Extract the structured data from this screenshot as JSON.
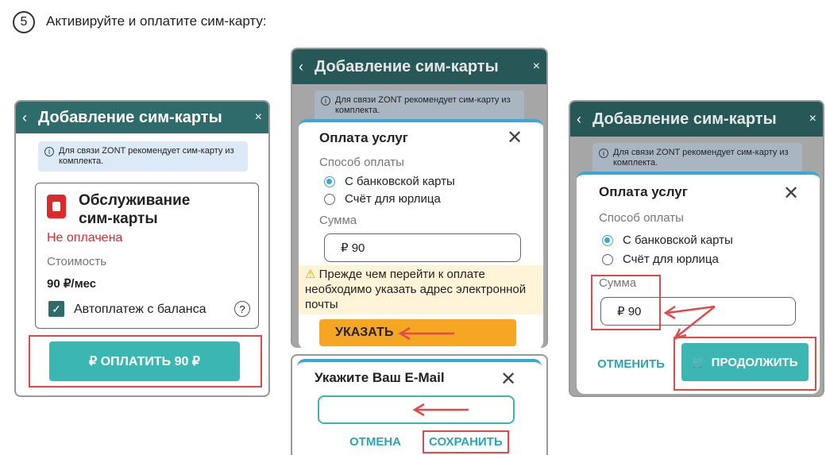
{
  "step": {
    "number": "5",
    "title": "Активируйте и оплатите сим-карту:"
  },
  "screen1": {
    "back": "‹",
    "title": "Добавление сим-карты",
    "close": "×",
    "info": "Для связи ZONT рекомендует сим-карту из комплекта.",
    "card_title": "Обслуживание сим-карты",
    "status": "Не оплачена",
    "cost_label": "Стоимость",
    "cost_value": "90 ₽/мес",
    "autopay_label": "Автоплатеж с баланса",
    "help": "?",
    "pay_button": "₽ ОПЛАТИТЬ 90 ₽"
  },
  "screen2": {
    "back": "‹",
    "title": "Добавление сим-карты",
    "close": "×",
    "info": "Для связи ZONT рекомендует сим-карту из комплекта.",
    "dialog_title": "Оплата услуг",
    "dialog_close": "✕",
    "method_label": "Способ оплаты",
    "option_card": "С банковской карты",
    "option_invoice": "Счёт для юрлица",
    "amount_label": "Сумма",
    "amount_value": "₽ 90",
    "warning_icon": "⚠",
    "warning": "Прежде чем перейти к оплате необходимо указать адрес электронной почты",
    "specify_button": "УКАЗАТЬ"
  },
  "screen3": {
    "title": "Укажите Ваш E-Mail",
    "close": "✕",
    "email_value": "",
    "cancel": "ОТМЕНА",
    "save": "СОХРАНИТЬ"
  },
  "screen4": {
    "back": "‹",
    "title": "Добавление сим-карты",
    "close": "×",
    "info": "Для связи ZONT рекомендует сим-карту из комплекта.",
    "dialog_title": "Оплата услуг",
    "dialog_close": "✕",
    "method_label": "Способ оплаты",
    "option_card": "С банковской карты",
    "option_invoice": "Счёт для юрлица",
    "amount_label": "Сумма",
    "amount_value": "₽ 90",
    "cancel": "ОТМЕНИТЬ",
    "continue_icon": "🛒",
    "continue": "ПРОДОЛЖИТЬ"
  },
  "colors": {
    "appbar": "#2f6b6b",
    "accent": "#3cb6b2",
    "warning": "#f5a623",
    "highlight": "#e04a4a",
    "dialog_border": "#3aa7d6"
  }
}
